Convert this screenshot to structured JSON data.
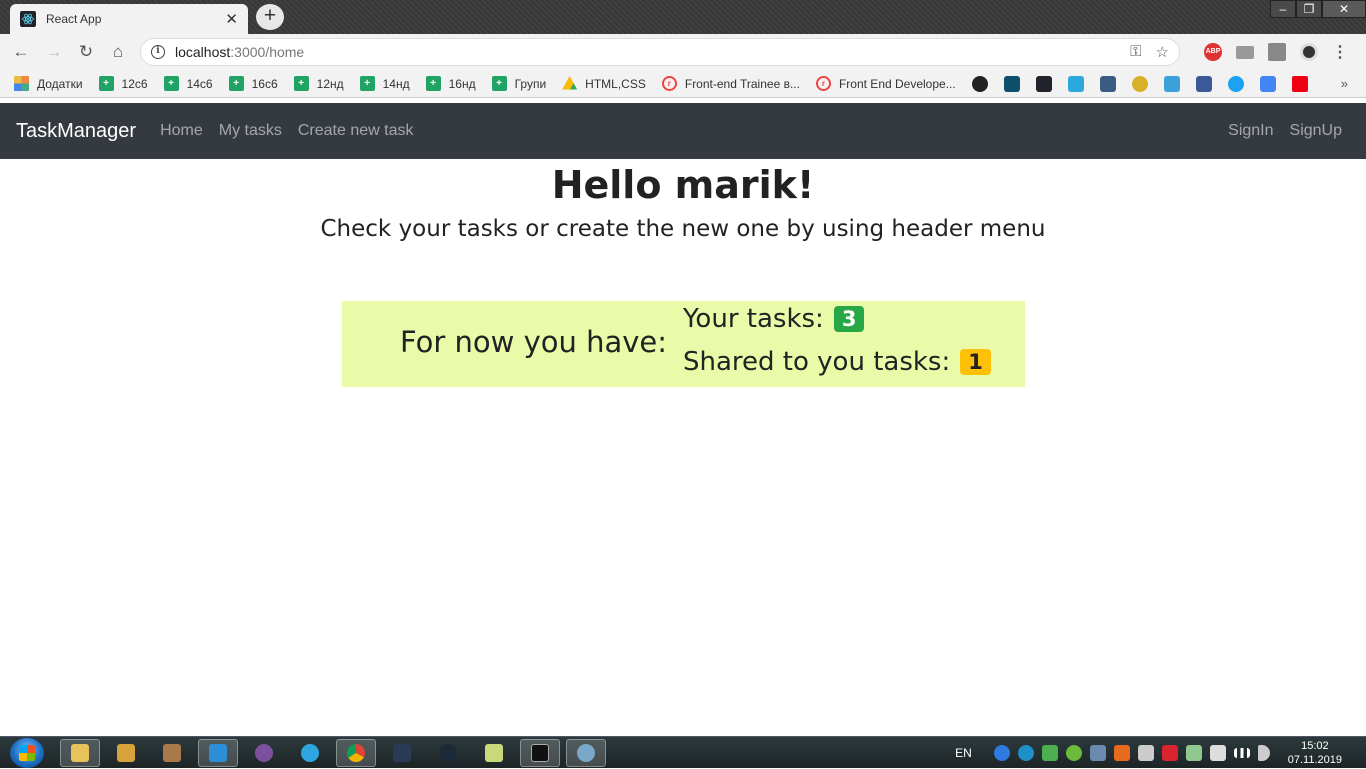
{
  "browser": {
    "tab_title": "React App",
    "url_host": "localhost",
    "url_path": ":3000/home",
    "bookmarks": [
      {
        "label": "Додатки",
        "icon": "apps-grid-icon"
      },
      {
        "label": "12с6",
        "icon": "sheets-icon"
      },
      {
        "label": "14с6",
        "icon": "sheets-icon"
      },
      {
        "label": "16с6",
        "icon": "sheets-icon"
      },
      {
        "label": "12нд",
        "icon": "sheets-icon"
      },
      {
        "label": "14нд",
        "icon": "sheets-icon"
      },
      {
        "label": "16нд",
        "icon": "sheets-icon"
      },
      {
        "label": "Групи",
        "icon": "sheets-icon"
      },
      {
        "label": "HTML,CSS",
        "icon": "drive-icon"
      },
      {
        "label": "Front-end Trainee в...",
        "icon": "rabota-icon"
      },
      {
        "label": "Front End Develope...",
        "icon": "rabota-icon"
      }
    ],
    "abp_label": "ABP",
    "more_glyph": "»"
  },
  "app": {
    "brand": "TaskManager",
    "nav_links": [
      "Home",
      "My tasks",
      "Create new task"
    ],
    "nav_right": [
      "SignIn",
      "SignUp"
    ],
    "greeting_prefix": "Hello ",
    "username": "marik!",
    "subtitle": "Check your tasks or create the new one by using header menu",
    "summary_lead": "For now you have:",
    "your_tasks_label": "Your tasks:",
    "your_tasks_count": "3",
    "shared_tasks_label": "Shared to you tasks:",
    "shared_tasks_count": "1"
  },
  "taskbar": {
    "language": "EN",
    "time": "15:02",
    "date": "07.11.2019"
  },
  "colors": {
    "navbar_bg": "#343a40",
    "summary_bg": "#e9fba8",
    "badge_green": "#28a745",
    "badge_yellow": "#ffc107"
  }
}
